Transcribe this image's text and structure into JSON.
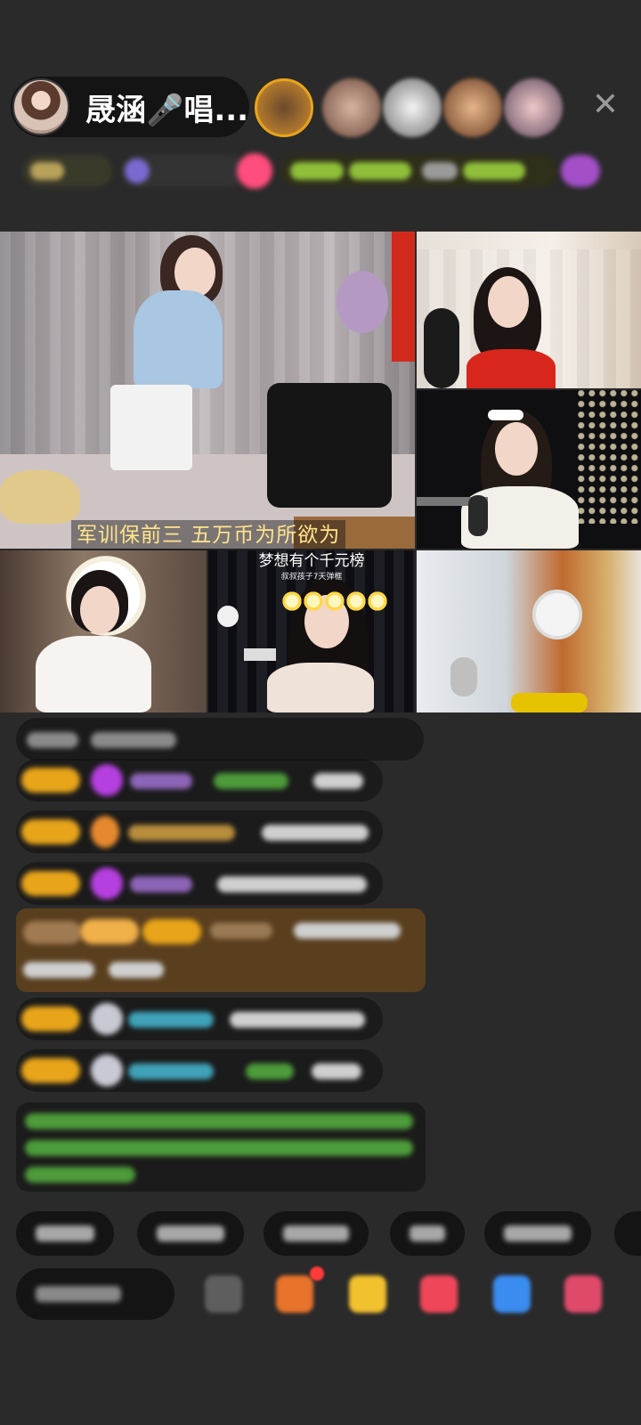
{
  "header": {
    "host_name": "晟涵🎤唱...",
    "close_symbol": "✕"
  },
  "video": {
    "main_caption": "军训保前三  五万币为所欲为",
    "tile_caption": "梦想有个千元榜",
    "tile_subcaption": "叔叔孩子7天弹框"
  },
  "colors": {
    "background": "#2a2a2a",
    "caption_yellow": "#ffe58a",
    "badge_gold": "#e8a51a",
    "highlight_bar": "#5a3f1f"
  }
}
